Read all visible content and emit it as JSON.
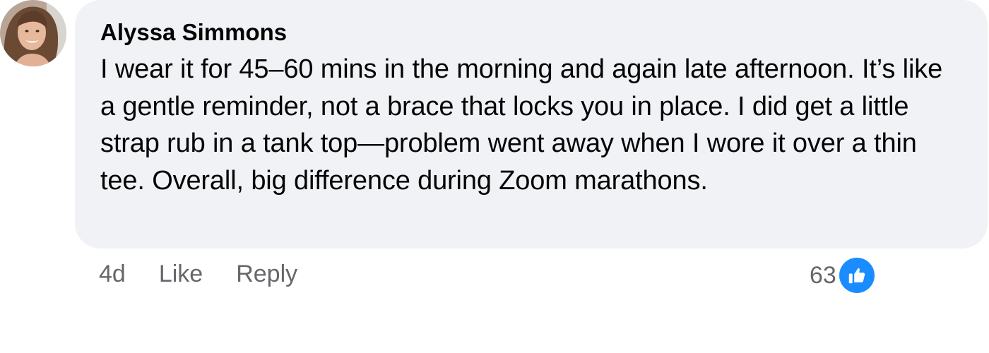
{
  "comment": {
    "author": "Alyssa Simmons",
    "text": "I wear it for 45–60 mins in the morning and again late afternoon. It’s like a gentle reminder, not a brace that locks you in place. I did get a little strap rub in a tank top—problem went away when I wore it over a thin tee. Overall, big difference during Zoom marathons.",
    "timestamp": "4d",
    "like_label": "Like",
    "reply_label": "Reply",
    "reaction_count": "63",
    "reaction_icon": "thumbs-up-icon",
    "reaction_color": "#1a8cff",
    "bubble_color": "#f0f2f5",
    "meta_text_color": "#65676b"
  }
}
